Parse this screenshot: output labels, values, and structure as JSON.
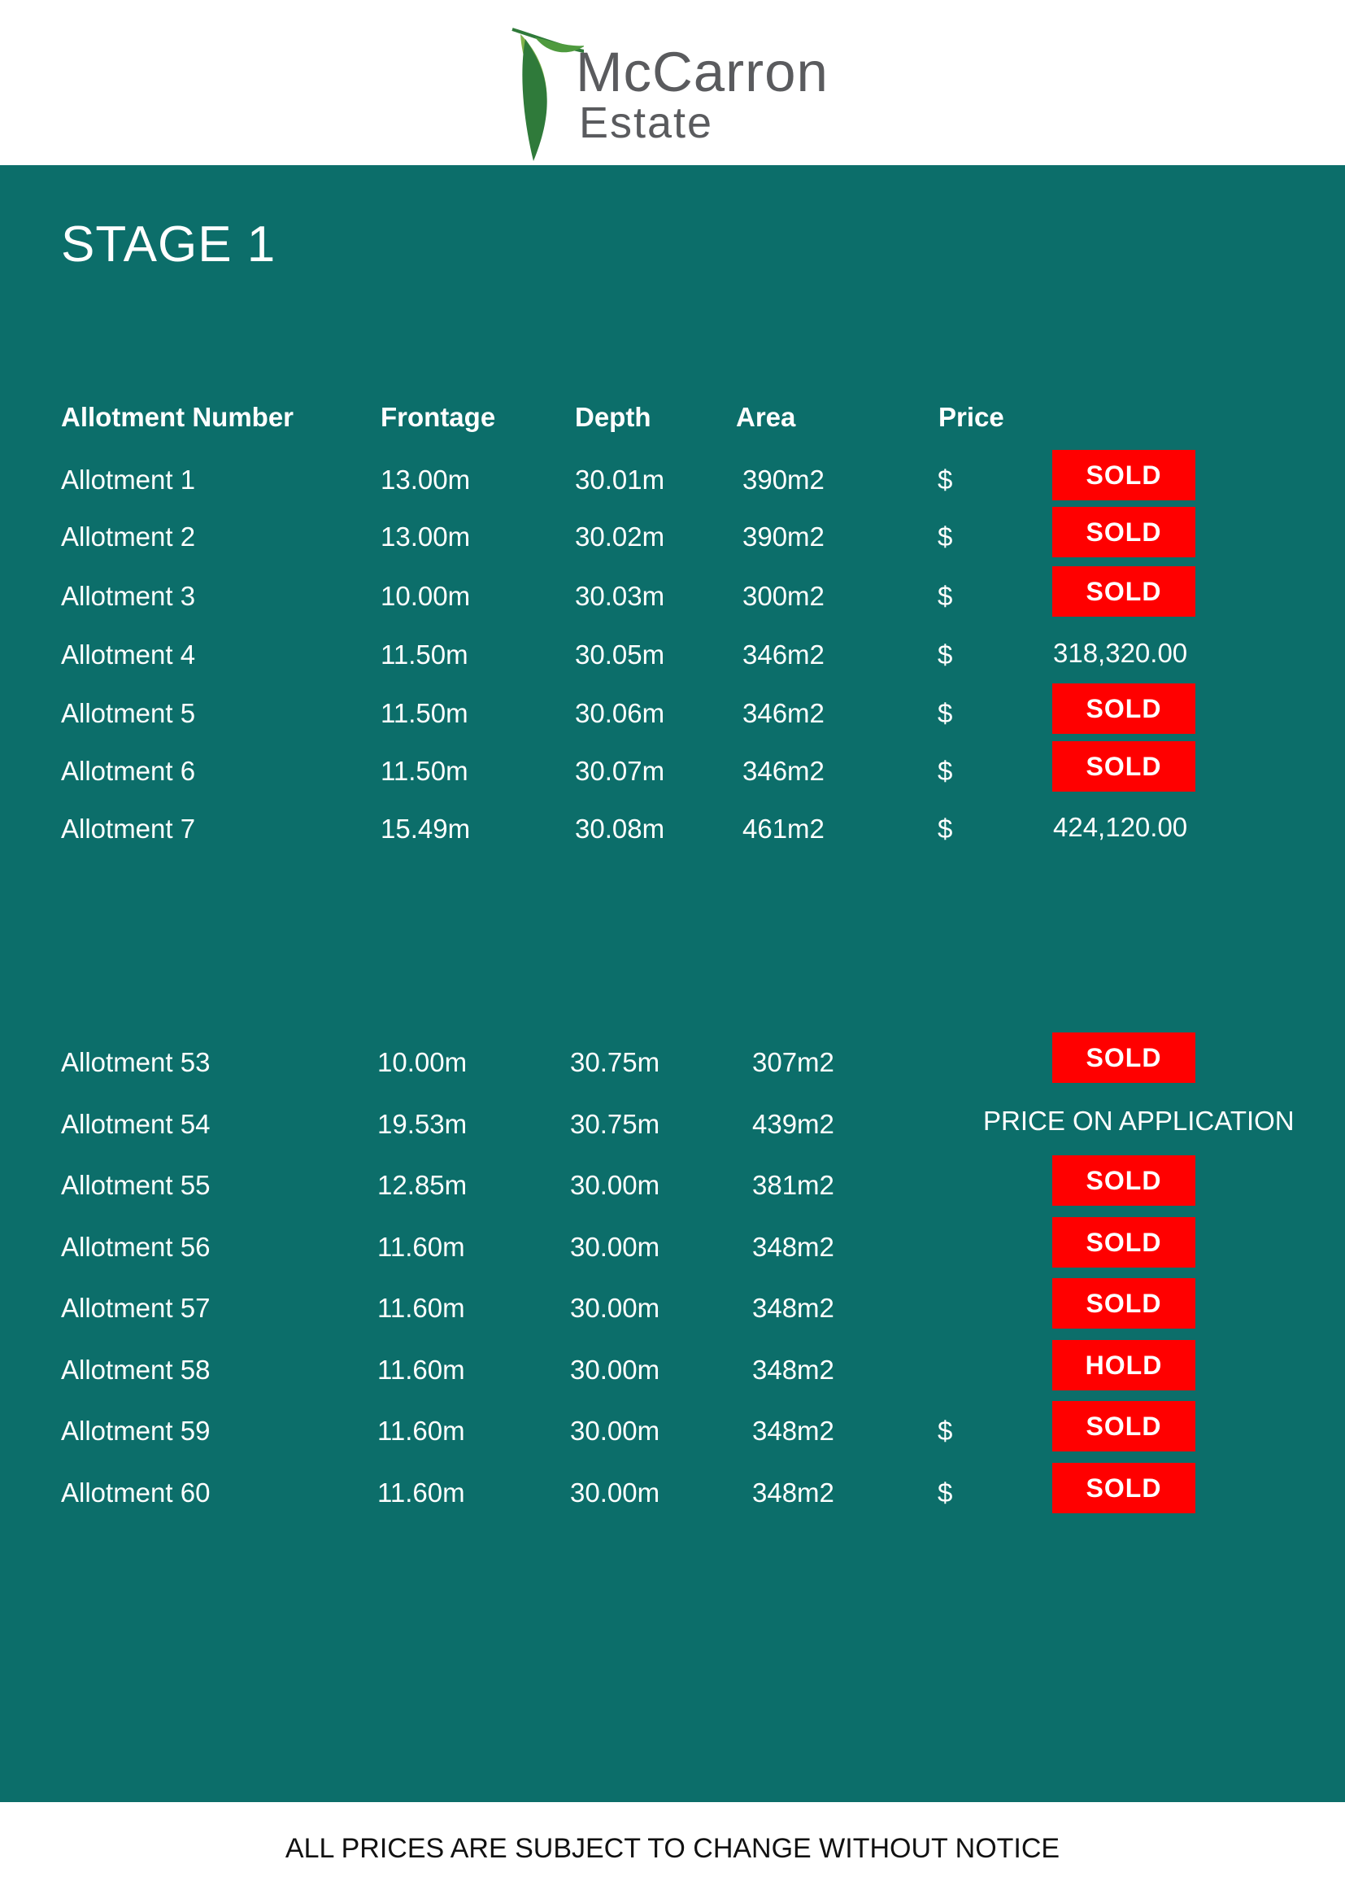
{
  "brand": {
    "name": "McCarron",
    "subtitle": "Estate",
    "colors": {
      "leaf_dark": "#2f7a3a",
      "leaf_light": "#7fb24a",
      "text": "#5a5b5e",
      "panel": "#0c6e6a",
      "badge": "#ff0000"
    }
  },
  "stage_title": "STAGE 1",
  "headers": {
    "allotment": "Allotment  Number",
    "frontage": "Frontage",
    "depth": "Depth",
    "area": "Area",
    "price": "Price"
  },
  "group1": [
    {
      "allotment": "Allotment 1",
      "frontage": "13.00m",
      "depth": "30.01m",
      "area": "390m2",
      "currency": "$",
      "status": "SOLD"
    },
    {
      "allotment": "Allotment 2",
      "frontage": "13.00m",
      "depth": "30.02m",
      "area": "390m2",
      "currency": "$",
      "status": "SOLD"
    },
    {
      "allotment": "Allotment 3",
      "frontage": "10.00m",
      "depth": "30.03m",
      "area": "300m2",
      "currency": "$",
      "status": "SOLD"
    },
    {
      "allotment": "Allotment 4",
      "frontage": "11.50m",
      "depth": "30.05m",
      "area": "346m2",
      "currency": "$",
      "price": "318,320.00"
    },
    {
      "allotment": "Allotment 5",
      "frontage": "11.50m",
      "depth": "30.06m",
      "area": "346m2",
      "currency": "$",
      "status": "SOLD"
    },
    {
      "allotment": "Allotment 6",
      "frontage": "11.50m",
      "depth": "30.07m",
      "area": "346m2",
      "currency": "$",
      "status": "SOLD"
    },
    {
      "allotment": "Allotment 7",
      "frontage": "15.49m",
      "depth": "30.08m",
      "area": "461m2",
      "currency": "$",
      "price": "424,120.00"
    }
  ],
  "group2": [
    {
      "allotment": "Allotment 53",
      "frontage": "10.00m",
      "depth": "30.75m",
      "area": "307m2",
      "status": "SOLD"
    },
    {
      "allotment": "Allotment 54",
      "frontage": "19.53m",
      "depth": "30.75m",
      "area": "439m2",
      "note": "PRICE ON APPLICATION"
    },
    {
      "allotment": "Allotment 55",
      "frontage": "12.85m",
      "depth": "30.00m",
      "area": "381m2",
      "status": "SOLD"
    },
    {
      "allotment": "Allotment 56",
      "frontage": "11.60m",
      "depth": "30.00m",
      "area": "348m2",
      "status": "SOLD"
    },
    {
      "allotment": "Allotment 57",
      "frontage": "11.60m",
      "depth": "30.00m",
      "area": "348m2",
      "status": "SOLD"
    },
    {
      "allotment": "Allotment 58",
      "frontage": "11.60m",
      "depth": "30.00m",
      "area": "348m2",
      "status": "HOLD"
    },
    {
      "allotment": "Allotment 59",
      "frontage": "11.60m",
      "depth": "30.00m",
      "area": "348m2",
      "currency": "$",
      "status": "SOLD"
    },
    {
      "allotment": "Allotment 60",
      "frontage": "11.60m",
      "depth": "30.00m",
      "area": "348m2",
      "currency": "$",
      "status": "SOLD"
    }
  ],
  "footer_note": "ALL PRICES ARE SUBJECT TO CHANGE WITHOUT NOTICE"
}
